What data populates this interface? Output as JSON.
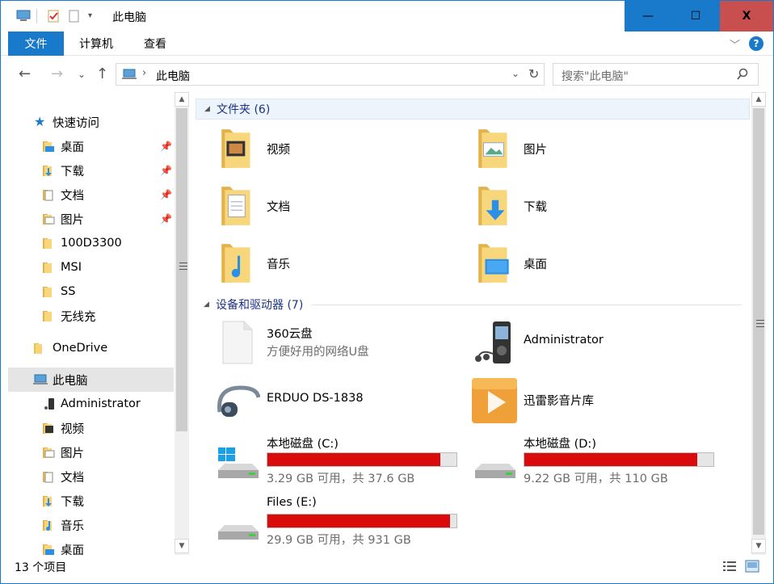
{
  "window": {
    "title": "此电脑",
    "buttons": {
      "minimize": "—",
      "maximize": "☐",
      "close": "X"
    }
  },
  "ribbon": {
    "tabs": [
      "文件",
      "计算机",
      "查看"
    ],
    "help": "?"
  },
  "address": {
    "path": "此电脑",
    "search_placeholder": "搜索\"此电脑\""
  },
  "navpane": {
    "quick_access": "快速访问",
    "items": [
      {
        "label": "桌面",
        "icon": "desktop-folder-icon",
        "pinned": true
      },
      {
        "label": "下载",
        "icon": "downloads-folder-icon",
        "pinned": true
      },
      {
        "label": "文档",
        "icon": "documents-folder-icon",
        "pinned": true
      },
      {
        "label": "图片",
        "icon": "pictures-folder-icon",
        "pinned": true
      },
      {
        "label": "100D3300",
        "icon": "folder-icon"
      },
      {
        "label": "MSI",
        "icon": "folder-icon"
      },
      {
        "label": "SS",
        "icon": "folder-icon"
      },
      {
        "label": "无线充",
        "icon": "folder-icon"
      }
    ],
    "onedrive": "OneDrive",
    "this_pc": "此电脑",
    "pc_items": [
      {
        "label": "Administrator",
        "icon": "media-player-icon"
      },
      {
        "label": "视频",
        "icon": "videos-folder-icon"
      },
      {
        "label": "图片",
        "icon": "pictures-folder-icon"
      },
      {
        "label": "文档",
        "icon": "documents-folder-icon"
      },
      {
        "label": "下载",
        "icon": "downloads-folder-icon"
      },
      {
        "label": "音乐",
        "icon": "music-folder-icon"
      },
      {
        "label": "桌面",
        "icon": "desktop-folder-icon"
      }
    ]
  },
  "content": {
    "folders_header": "文件夹 (6)",
    "folders": [
      {
        "label": "视频",
        "icon": "videos-folder-icon"
      },
      {
        "label": "图片",
        "icon": "pictures-folder-icon"
      },
      {
        "label": "文档",
        "icon": "documents-folder-icon"
      },
      {
        "label": "下载",
        "icon": "downloads-folder-icon"
      },
      {
        "label": "音乐",
        "icon": "music-folder-icon"
      },
      {
        "label": "桌面",
        "icon": "desktop-folder-icon"
      }
    ],
    "devices_header": "设备和驱动器 (7)",
    "devices": [
      {
        "label": "360云盘",
        "sub": "方便好用的网络U盘",
        "icon": "cloud-drive-icon"
      },
      {
        "label": "Administrator",
        "icon": "media-player-icon"
      },
      {
        "label": "ERDUO DS-1838",
        "icon": "bluetooth-headset-icon"
      },
      {
        "label": "迅雷影音片库",
        "icon": "video-library-icon"
      }
    ],
    "drives": [
      {
        "label": "本地磁盘 (C:)",
        "free": "3.29 GB 可用，共 37.6 GB",
        "used_fraction": 0.9125,
        "icon": "windows-drive-icon"
      },
      {
        "label": "本地磁盘 (D:)",
        "free": "9.22 GB 可用，共 110 GB",
        "used_fraction": 0.9162,
        "icon": "hard-drive-icon"
      },
      {
        "label": "Files (E:)",
        "free": "29.9 GB 可用，共 931 GB",
        "used_fraction": 0.9679,
        "icon": "hard-drive-icon"
      }
    ]
  },
  "status": {
    "count": "13 个项目"
  },
  "colors": {
    "accent": "#1979ca",
    "close_button": "#c94f4f",
    "drive_bar_fill": "#da0b0b",
    "group_header_text": "#1e3287"
  }
}
